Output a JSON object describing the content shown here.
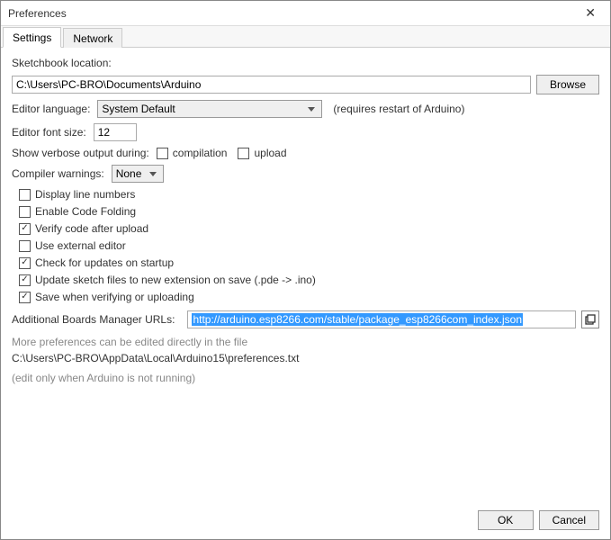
{
  "window": {
    "title": "Preferences"
  },
  "tabs": {
    "settings": "Settings",
    "network": "Network"
  },
  "sketchbook": {
    "label": "Sketchbook location:",
    "value": "C:\\Users\\PC-BRO\\Documents\\Arduino",
    "browse": "Browse"
  },
  "language": {
    "label": "Editor language:",
    "value": "System Default",
    "hint": "(requires restart of Arduino)"
  },
  "fontsize": {
    "label": "Editor font size:",
    "value": "12"
  },
  "verbose": {
    "label": "Show verbose output during:",
    "compilation": "compilation",
    "upload": "upload",
    "compilation_checked": false,
    "upload_checked": false
  },
  "warnings": {
    "label": "Compiler warnings:",
    "value": "None"
  },
  "options": [
    {
      "label": "Display line numbers",
      "checked": false
    },
    {
      "label": "Enable Code Folding",
      "checked": false
    },
    {
      "label": "Verify code after upload",
      "checked": true
    },
    {
      "label": "Use external editor",
      "checked": false
    },
    {
      "label": "Check for updates on startup",
      "checked": true
    },
    {
      "label": "Update sketch files to new extension on save (.pde -> .ino)",
      "checked": true
    },
    {
      "label": "Save when verifying or uploading",
      "checked": true
    }
  ],
  "urls": {
    "label": "Additional Boards Manager URLs:",
    "value": "http://arduino.esp8266.com/stable/package_esp8266com_index.json"
  },
  "footer": {
    "note1": "More preferences can be edited directly in the file",
    "path": "C:\\Users\\PC-BRO\\AppData\\Local\\Arduino15\\preferences.txt",
    "note2": "(edit only when Arduino is not running)"
  },
  "buttons": {
    "ok": "OK",
    "cancel": "Cancel"
  }
}
